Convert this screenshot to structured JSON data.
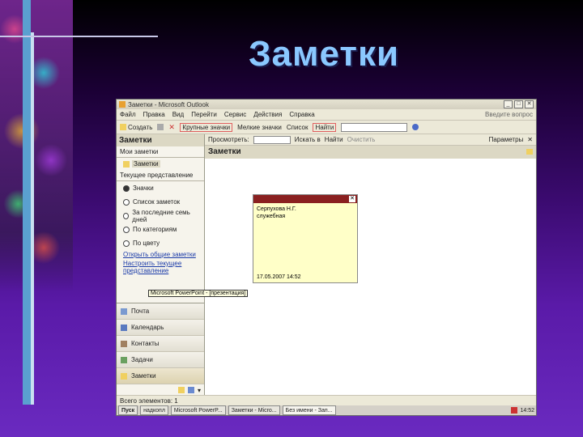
{
  "slide": {
    "title": "Заметки"
  },
  "window": {
    "title": "Заметки - Microsoft Outlook",
    "controls": [
      "_",
      "□",
      "✕"
    ]
  },
  "menu": {
    "items": [
      "Файл",
      "Правка",
      "Вид",
      "Перейти",
      "Сервис",
      "Действия",
      "Справка"
    ],
    "help_placeholder": "Введите вопрос"
  },
  "toolbar": {
    "create": "Создать",
    "large_icons": "Крупные значки",
    "small_icons": "Мелкие значки",
    "list": "Список",
    "find": "Найти"
  },
  "nav": {
    "header": "Заметки",
    "my_notes": "Мои заметки",
    "folder": "Заметки",
    "current_view_label": "Текущее представление",
    "views": [
      {
        "label": "Значки",
        "selected": true
      },
      {
        "label": "Список заметок",
        "selected": false
      },
      {
        "label": "За последние семь дней",
        "selected": false
      },
      {
        "label": "По категориям",
        "selected": false
      },
      {
        "label": "По цвету",
        "selected": false
      }
    ],
    "links": [
      "Открыть общие заметки",
      "Настроить текущее представление"
    ],
    "buttons": [
      {
        "label": "Почта",
        "icon": "mail-icon"
      },
      {
        "label": "Календарь",
        "icon": "calendar-icon"
      },
      {
        "label": "Контакты",
        "icon": "contacts-icon"
      },
      {
        "label": "Задачи",
        "icon": "tasks-icon"
      },
      {
        "label": "Заметки",
        "icon": "notes-icon",
        "active": true
      }
    ]
  },
  "main": {
    "filter": {
      "search_label": "Просмотреть:",
      "in_label": "Искать в",
      "find_label": "Найти",
      "clear": "Очистить",
      "options": "Параметры"
    },
    "header": "Заметки"
  },
  "note": {
    "text": "Серпухова Н.Г.",
    "subtext": "служебная",
    "date": "17.05.2007 14:52"
  },
  "statusbar": {
    "text": "Всего элементов: 1"
  },
  "tooltip": "Microsoft PowerPoint - [презентация]",
  "taskbar": {
    "start": "Пуск",
    "items": [
      "надкопл",
      "Microsoft PowerP...",
      "Заметки - Micro...",
      "Без имени - Зап..."
    ],
    "clock": "14:52"
  }
}
